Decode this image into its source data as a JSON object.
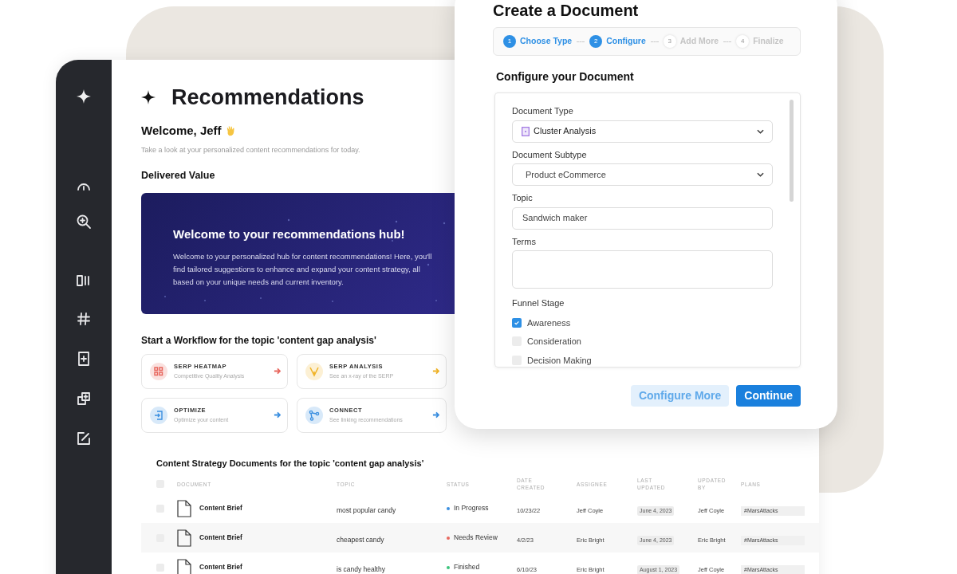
{
  "sidebar": {
    "items": [
      {
        "kind": "sparkle"
      },
      {
        "kind": "gauge"
      },
      {
        "kind": "zoom"
      },
      {
        "kind": "columns"
      },
      {
        "kind": "hash"
      },
      {
        "kind": "add-doc"
      },
      {
        "kind": "copy"
      },
      {
        "kind": "edit"
      }
    ]
  },
  "page": {
    "title": "Recommendations",
    "welcome": "Welcome, Jeff",
    "subtitle": "Take a look at your personalized content recommendations for today.",
    "section_title": "Delivered Value"
  },
  "banner": {
    "title": "Welcome to your recommendations hub!",
    "text": "Welcome to your personalized hub for content recommendations! Here, you'll find tailored suggestions to enhance and expand your content strategy, all based on your unique needs and current inventory."
  },
  "workflows": {
    "title": "Start a Workflow for the topic 'content gap analysis'",
    "cards": [
      {
        "kind": "grid",
        "title": "SERP HEATMAP",
        "subtitle": "Competitive Quality Analysis",
        "color": "#e8685f"
      },
      {
        "kind": "funnel",
        "title": "SERP ANALYSIS",
        "subtitle": "See an x-ray of the SERP",
        "color": "#f0b429"
      },
      {
        "kind": "login",
        "title": "OPTIMIZE",
        "subtitle": "Optimize your content",
        "color": "#3b8fe0"
      },
      {
        "kind": "branch",
        "title": "CONNECT",
        "subtitle": "See linking recommendations",
        "color": "#3b8fe0"
      }
    ]
  },
  "table": {
    "title": "Content Strategy Documents for the topic 'content gap analysis'",
    "all_checked": false,
    "columns": [
      "DOCUMENT",
      "TOPIC",
      "STATUS",
      "DATE CREATED",
      "ASSIGNEE",
      "LAST UPDATED",
      "UPDATED BY",
      "PLANS"
    ],
    "rows": [
      {
        "document": "Content Brief",
        "topic": "most popular candy",
        "checked": false,
        "status": "In Progress",
        "color": "#3b8fe0",
        "date_created": "10/23/22",
        "assignee": "Jeff Coyle",
        "last_updated": "June 4, 2023",
        "updated_by": "Jeff Coyle",
        "plans": "#MarsAttacks"
      },
      {
        "document": "Content Brief",
        "topic": "cheapest candy",
        "checked": false,
        "status": "Needs Review",
        "color": "#e8685f",
        "date_created": "4/2/23",
        "assignee": "Eric Bright",
        "last_updated": "June 4, 2023",
        "updated_by": "Eric Bright",
        "plans": "#MarsAttacks"
      },
      {
        "document": "Content Brief",
        "topic": "is candy healthy",
        "checked": false,
        "status": "Finished",
        "color": "#3cc47c",
        "date_created": "6/10/23",
        "assignee": "Eric Bright",
        "last_updated": "August 1, 2023",
        "updated_by": "Jeff Coyle",
        "plans": "#MarsAttacks"
      }
    ]
  },
  "dialog": {
    "title": "Create a Document",
    "steps": [
      {
        "number": "1",
        "label": "Choose Type",
        "active": true
      },
      {
        "number": "2",
        "label": "Configure",
        "active": true
      },
      {
        "number": "3",
        "label": "Add More",
        "active": false
      },
      {
        "number": "4",
        "label": "Finalize",
        "active": false
      }
    ],
    "section_title": "Configure your Document",
    "fields": [
      {
        "kind": "select",
        "label": "Document Type",
        "value": "Cluster Analysis",
        "icon": true
      },
      {
        "kind": "select",
        "label": "Document Subtype",
        "value": "Product eCommerce"
      },
      {
        "kind": "text",
        "label": "Topic",
        "value": "Sandwich maker"
      },
      {
        "kind": "textarea",
        "label": "Terms"
      }
    ],
    "funnel": {
      "label": "Funnel Stage",
      "options": [
        {
          "label": "Awareness",
          "checked": true
        },
        {
          "label": "Consideration",
          "checked": false
        },
        {
          "label": "Decision Making",
          "checked": false
        }
      ]
    },
    "buttons": [
      {
        "kind": "secondary",
        "label": "Configure More"
      },
      {
        "kind": "primary",
        "label": "Continue"
      }
    ]
  }
}
